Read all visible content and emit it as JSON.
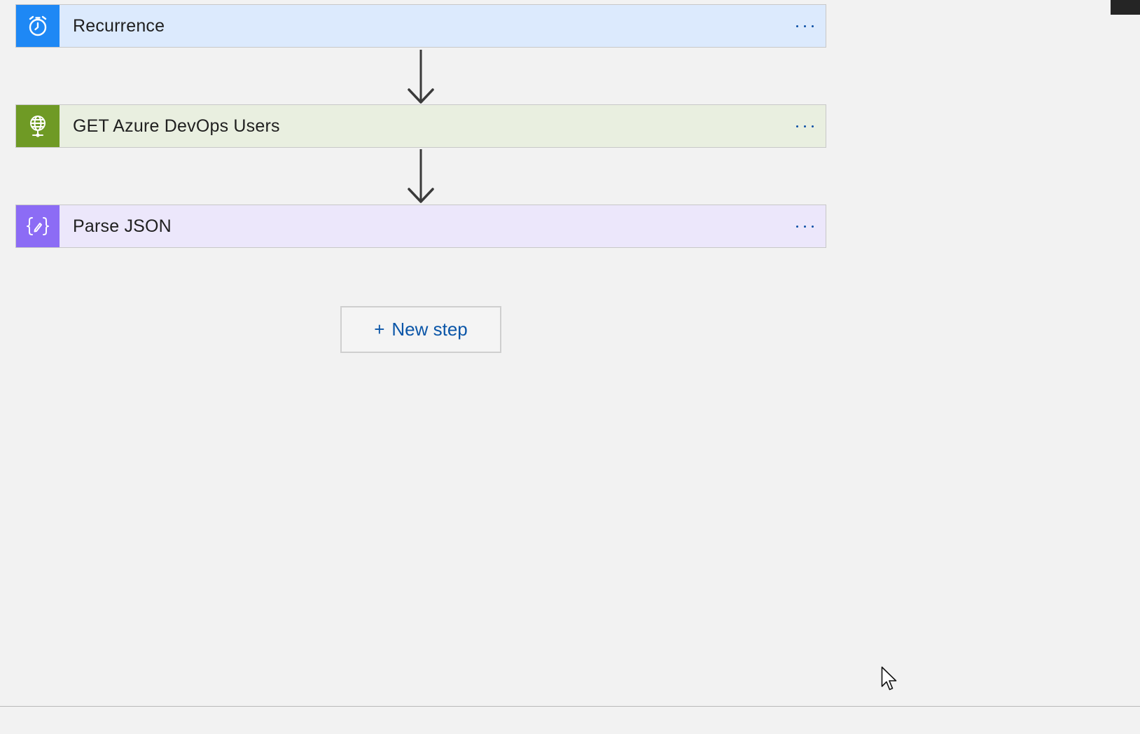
{
  "flow": {
    "steps": [
      {
        "title": "Recurrence",
        "icon": "alarm-clock-icon",
        "icon_bg": "#1e88f5",
        "card_bg": "#dceafd",
        "menu": "more-options"
      },
      {
        "title": "GET Azure DevOps Users",
        "icon": "globe-http-icon",
        "icon_bg": "#6f9a25",
        "card_bg": "#e9efe0",
        "menu": "more-options"
      },
      {
        "title": "Parse JSON",
        "icon": "json-braces-icon",
        "icon_bg": "#8c6cf5",
        "card_bg": "#ece7fb",
        "menu": "more-options"
      }
    ],
    "new_step": {
      "plus": "+",
      "label": "New step"
    }
  },
  "colors": {
    "canvas_bg": "#f2f2f2",
    "link_blue": "#0b56a8",
    "arrow": "#3a3a3a"
  }
}
